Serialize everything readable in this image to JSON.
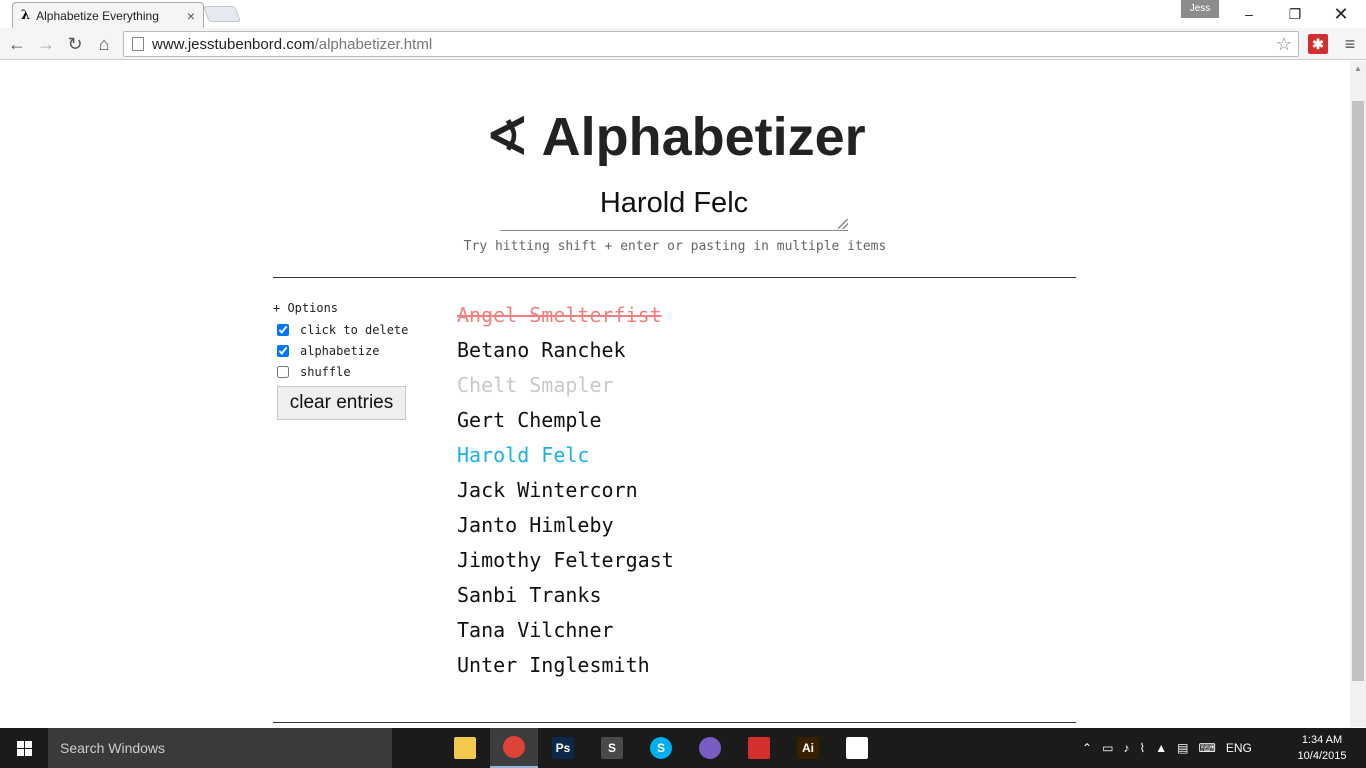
{
  "browser": {
    "tab_icon": "λ",
    "tab_title": "Alphabetize Everything",
    "tab_close": "×",
    "profile_name": "Jess",
    "url_host": "www.jesstubenbord.com",
    "url_path": "/alphabetizer.html"
  },
  "page": {
    "heading_symbol": "∢",
    "heading_text": "Alphabetizer",
    "input_value": "Harold Felc",
    "hint": "Try hitting shift + enter or pasting in multiple items",
    "options_toggle": "+ Options",
    "options": [
      {
        "label": "click to delete",
        "checked": true
      },
      {
        "label": "alphabetize",
        "checked": true
      },
      {
        "label": "shuffle",
        "checked": false
      }
    ],
    "clear_label": "clear entries",
    "entries": [
      {
        "text": "Angel Smelterfist",
        "state": "deleted"
      },
      {
        "text": "Betano Ranchek",
        "state": "normal"
      },
      {
        "text": "Chelt Smapler",
        "state": "faded"
      },
      {
        "text": "Gert Chemple",
        "state": "normal"
      },
      {
        "text": "Harold Felc",
        "state": "highlight"
      },
      {
        "text": "Jack Wintercorn",
        "state": "normal"
      },
      {
        "text": "Janto Himleby",
        "state": "normal"
      },
      {
        "text": "Jimothy Feltergast",
        "state": "normal"
      },
      {
        "text": "Sanbi Tranks",
        "state": "normal"
      },
      {
        "text": "Tana Vilchner",
        "state": "normal"
      },
      {
        "text": "Unter Inglesmith",
        "state": "normal"
      }
    ]
  },
  "taskbar": {
    "search_placeholder": "Search Windows",
    "language": "ENG",
    "time": "1:34 AM",
    "date": "10/4/2015",
    "apps": [
      {
        "name": "task-view-icon",
        "glyph": "",
        "color": "#1b1b1b"
      },
      {
        "name": "file-explorer-icon",
        "glyph": "",
        "color": "#f2c94c"
      },
      {
        "name": "chrome-icon",
        "glyph": "",
        "color": "#db4437"
      },
      {
        "name": "photoshop-icon",
        "glyph": "Ps",
        "color": "#0b2a4a"
      },
      {
        "name": "sublime-icon",
        "glyph": "S",
        "color": "#4a4a4a"
      },
      {
        "name": "skype-icon",
        "glyph": "S",
        "color": "#00aff0"
      },
      {
        "name": "github-icon",
        "glyph": "",
        "color": "#7b5cc4"
      },
      {
        "name": "acrobat-icon",
        "glyph": "",
        "color": "#d32f2f"
      },
      {
        "name": "illustrator-icon",
        "glyph": "Ai",
        "color": "#3b2000"
      },
      {
        "name": "photos-icon",
        "glyph": "",
        "color": "#ffffff"
      }
    ]
  }
}
